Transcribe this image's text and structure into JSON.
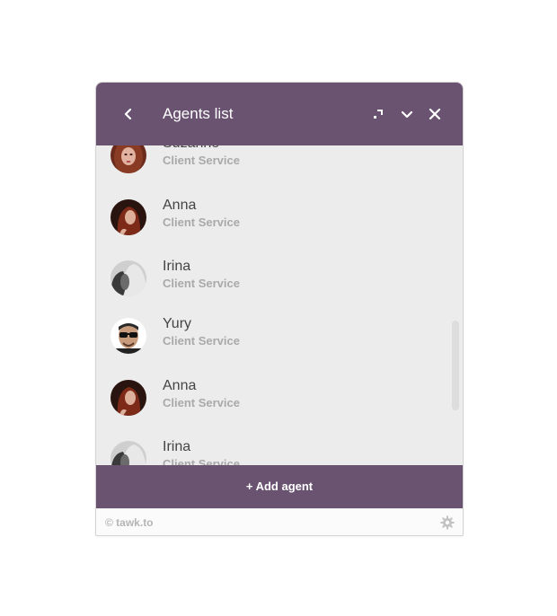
{
  "header": {
    "title": "Agents list",
    "back_icon": "chevron-left-icon",
    "expand_icon": "expand-icon",
    "minimize_icon": "chevron-down-icon",
    "close_icon": "close-icon"
  },
  "agents": [
    {
      "name": "Suzanne",
      "role": "Client Service",
      "avatar": "avatar-suzanne"
    },
    {
      "name": "Anna",
      "role": "Client Service",
      "avatar": "avatar-anna"
    },
    {
      "name": "Irina",
      "role": "Client Service",
      "avatar": "avatar-irina"
    },
    {
      "name": "Yury",
      "role": "Client Service",
      "avatar": "avatar-yury"
    },
    {
      "name": "Anna",
      "role": "Client Service",
      "avatar": "avatar-anna"
    },
    {
      "name": "Irina",
      "role": "Client Service",
      "avatar": "avatar-irina"
    }
  ],
  "add_button": {
    "label": "+ Add agent"
  },
  "footer": {
    "brand": "© tawk.to",
    "settings_icon": "gear-icon"
  },
  "colors": {
    "accent": "#6a5371",
    "list_bg": "#ececec",
    "role_text": "#a9a9a9"
  }
}
